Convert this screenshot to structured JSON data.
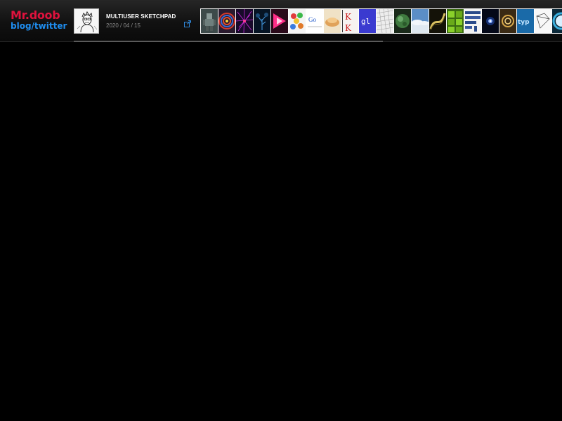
{
  "logo": {
    "title": "Mr.doob",
    "links": "blog/twitter"
  },
  "feature": {
    "title": "MULTIUSER SKETCHPAD",
    "date": "2020 / 04 / 15",
    "thumb_icon": "sketch-portrait-icon",
    "link_icon": "external-link-icon"
  },
  "progress": {
    "fraction": 1.0
  },
  "thumbnails": [
    {
      "name": "robot-thumb",
      "label": ""
    },
    {
      "name": "concentric-rings-thumb",
      "label": ""
    },
    {
      "name": "purple-lines-thumb",
      "label": ""
    },
    {
      "name": "dark-tree-thumb",
      "label": ""
    },
    {
      "name": "pink-triangles-thumb",
      "label": ""
    },
    {
      "name": "colored-balls-thumb",
      "label": ""
    },
    {
      "name": "google-gravity-thumb",
      "label": "Go"
    },
    {
      "name": "orange-swirl-thumb",
      "label": ""
    },
    {
      "name": "k-letters-thumb",
      "label": "K"
    },
    {
      "name": "gl-thumb",
      "label": "gl"
    },
    {
      "name": "white-mesh-thumb",
      "label": ""
    },
    {
      "name": "green-planet-thumb",
      "label": ""
    },
    {
      "name": "sky-clouds-thumb",
      "label": ""
    },
    {
      "name": "yellow-ribbon-thumb",
      "label": ""
    },
    {
      "name": "green-cubes-thumb",
      "label": ""
    },
    {
      "name": "blue-blocks-thumb",
      "label": ""
    },
    {
      "name": "glow-star-thumb",
      "label": ""
    },
    {
      "name": "gold-swirl-thumb",
      "label": ""
    },
    {
      "name": "type-thumb",
      "label": "typ"
    },
    {
      "name": "wireframe-thumb",
      "label": ""
    },
    {
      "name": "color-ring-thumb",
      "label": ""
    }
  ],
  "colors": {
    "logo_red": "#e0123d",
    "logo_blue": "#1f8ef0",
    "link_blue": "#2f86d8",
    "background": "#000000"
  }
}
